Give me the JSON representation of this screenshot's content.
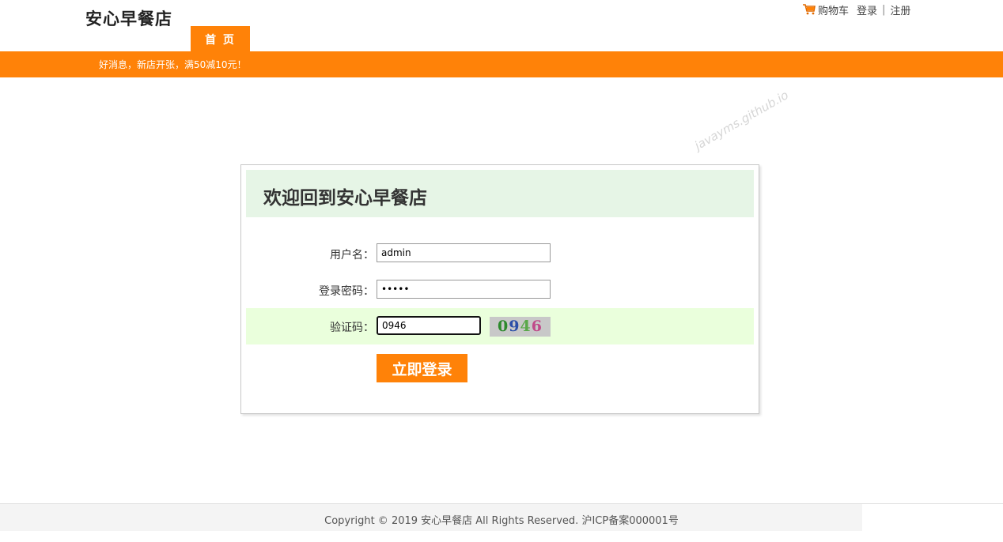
{
  "header": {
    "site_title": "安心早餐店",
    "nav_tab": "首 页",
    "links": {
      "cart": "购物车",
      "login": "登录",
      "separator": "|",
      "register": "注册"
    },
    "cart_icon": "shopping-cart-icon",
    "accent_color": "#ff8208"
  },
  "notice": {
    "text": "好消息，新店开张，满50减10元！"
  },
  "watermark": "javayms.github.io",
  "login": {
    "title": "欢迎回到安心早餐店",
    "username_label": "用户名：",
    "username_value": "admin",
    "password_label": "登录密码：",
    "password_value": "•••••",
    "captcha_label": "验证码：",
    "captcha_value": "0946",
    "captcha_image_text": [
      "0",
      "9",
      "4",
      "6"
    ],
    "submit_label": "立即登录"
  },
  "footer": {
    "copyright": "Copyright © 2019 安心早餐店 All Rights Reserved. 沪ICP备案000001号"
  }
}
